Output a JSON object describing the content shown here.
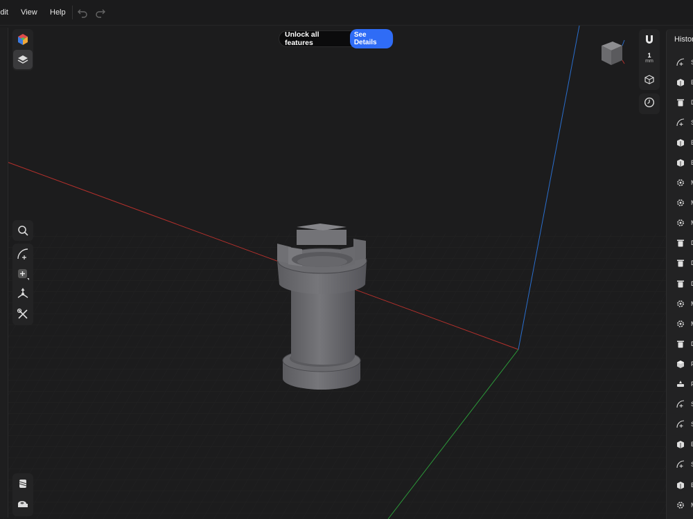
{
  "menu": {
    "items": [
      "Edit",
      "View",
      "Help"
    ]
  },
  "banner": {
    "text": "Unlock all features",
    "button": "See Details"
  },
  "snap": {
    "value": "1",
    "unit": "mm"
  },
  "history": {
    "title": "History",
    "items": [
      {
        "label": "S",
        "icon": "sketch-icon"
      },
      {
        "label": "E",
        "icon": "extrude-icon"
      },
      {
        "label": "D",
        "icon": "delete-icon"
      },
      {
        "label": "S",
        "icon": "sketch-icon"
      },
      {
        "label": "E",
        "icon": "extrude-icon"
      },
      {
        "label": "E",
        "icon": "extrude-icon"
      },
      {
        "label": "M",
        "icon": "modify-icon"
      },
      {
        "label": "M",
        "icon": "modify-icon"
      },
      {
        "label": "M",
        "icon": "modify-icon"
      },
      {
        "label": "D",
        "icon": "delete-icon"
      },
      {
        "label": "D",
        "icon": "delete-icon"
      },
      {
        "label": "D",
        "icon": "delete-icon"
      },
      {
        "label": "M",
        "icon": "modify-icon"
      },
      {
        "label": "M",
        "icon": "modify-icon"
      },
      {
        "label": "D",
        "icon": "delete-icon"
      },
      {
        "label": "F",
        "icon": "fillet-icon"
      },
      {
        "label": "F",
        "icon": "shell-icon"
      },
      {
        "label": "S",
        "icon": "sketch-icon"
      },
      {
        "label": "S",
        "icon": "sketch-icon"
      },
      {
        "label": "E",
        "icon": "extrude-icon"
      },
      {
        "label": "S",
        "icon": "sketch-icon"
      },
      {
        "label": "E",
        "icon": "extrude-icon"
      },
      {
        "label": "M",
        "icon": "modify-icon"
      }
    ]
  },
  "colors": {
    "accent": "#2f6cf6",
    "x_axis": "#b4302c",
    "y_axis": "#2c9a3a",
    "z_axis": "#2a6fcf"
  }
}
